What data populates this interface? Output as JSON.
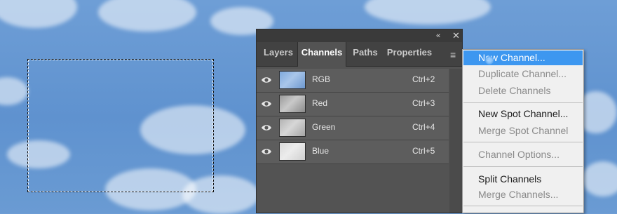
{
  "panel": {
    "collapse_icon": "«",
    "close_icon": "✕",
    "menu_icon": "≡",
    "tabs": [
      {
        "label": "Layers"
      },
      {
        "label": "Channels"
      },
      {
        "label": "Paths"
      },
      {
        "label": "Properties"
      }
    ],
    "active_tab": "Channels",
    "channels": [
      {
        "name": "RGB",
        "shortcut": "Ctrl+2"
      },
      {
        "name": "Red",
        "shortcut": "Ctrl+3"
      },
      {
        "name": "Green",
        "shortcut": "Ctrl+4"
      },
      {
        "name": "Blue",
        "shortcut": "Ctrl+5"
      }
    ]
  },
  "menu": {
    "items": [
      {
        "label": "New Channel...",
        "state": "highlighted"
      },
      {
        "label": "Duplicate Channel...",
        "state": "disabled"
      },
      {
        "label": "Delete Channels",
        "state": "disabled"
      },
      {
        "label": "New Spot Channel...",
        "state": "enabled"
      },
      {
        "label": "Merge Spot Channel",
        "state": "disabled"
      },
      {
        "label": "Channel Options...",
        "state": "disabled"
      },
      {
        "label": "Split Channels",
        "state": "enabled"
      },
      {
        "label": "Merge Channels...",
        "state": "disabled"
      }
    ]
  },
  "colors": {
    "highlight": "#3d97f0",
    "panel_bg": "#535353",
    "sky": "#6e9ed6"
  }
}
